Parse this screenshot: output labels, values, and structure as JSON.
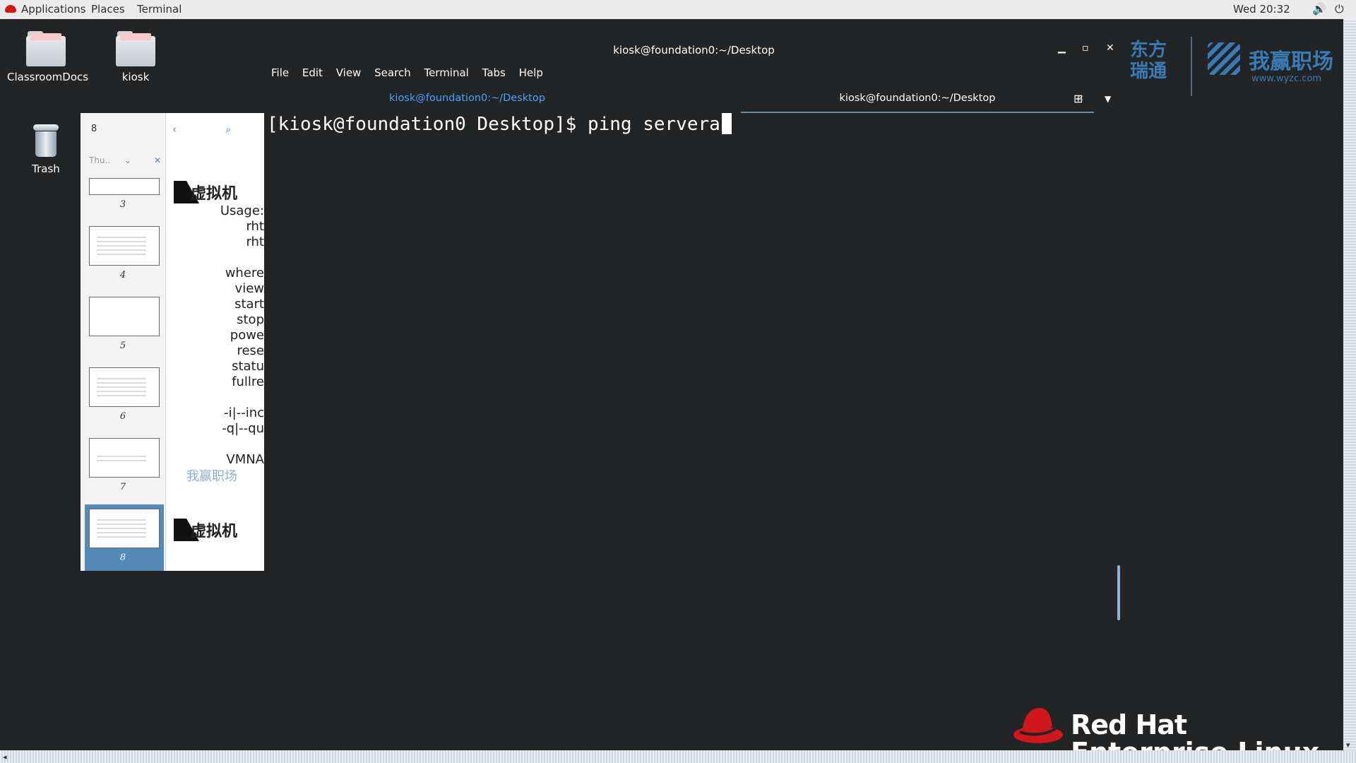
{
  "topbar": {
    "applications": "Applications",
    "places": "Places",
    "terminal": "Terminal",
    "clock": "Wed 20:32"
  },
  "desktop": {
    "icons": [
      {
        "label": "ClassroomDocs"
      },
      {
        "label": "kiosk"
      },
      {
        "label": "Trash"
      }
    ]
  },
  "terminal": {
    "title": "kiosk@foundation0:~/Desktop",
    "menu": [
      "File",
      "Edit",
      "View",
      "Search",
      "Terminal",
      "Tabs",
      "Help"
    ],
    "tabs": [
      {
        "label": "kiosk@foundation0:~/Desktop",
        "active": false
      },
      {
        "label": "kiosk@foundation0:~/Desktop",
        "active": true
      }
    ],
    "prompt_line": "[kiosk@foundation0 Desktop]$ ping servera"
  },
  "viewer": {
    "page_number": "8",
    "thumb_dropdown": "Thu..",
    "thumbnails": [
      {
        "label": "3"
      },
      {
        "label": "4"
      },
      {
        "label": "5"
      },
      {
        "label": "6"
      },
      {
        "label": "7"
      },
      {
        "label": "8",
        "selected": true
      }
    ],
    "heading": "虚拟机",
    "lines": [
      "Usage:",
      "rht",
      "rht",
      "",
      "where",
      "view",
      "start",
      "stop",
      "powe",
      "rese",
      "statu",
      "fullre",
      "",
      "-i|--inc",
      "-q|--qu",
      "",
      "VMNA"
    ],
    "watermark": "我赢职场"
  },
  "logos": {
    "cn_top": "东方",
    "cn_bottom": "瑞通",
    "wy": "我赢职场",
    "url": "www.wyzc.com"
  },
  "redhat": {
    "name": "Red Hat",
    "sub": "Enterprise Linux"
  },
  "colors": {
    "terminal_bg": "#232425",
    "redhat_red": "#d0181c",
    "tab_inactive": "#4aa2ff",
    "selection": "#5589b8"
  }
}
